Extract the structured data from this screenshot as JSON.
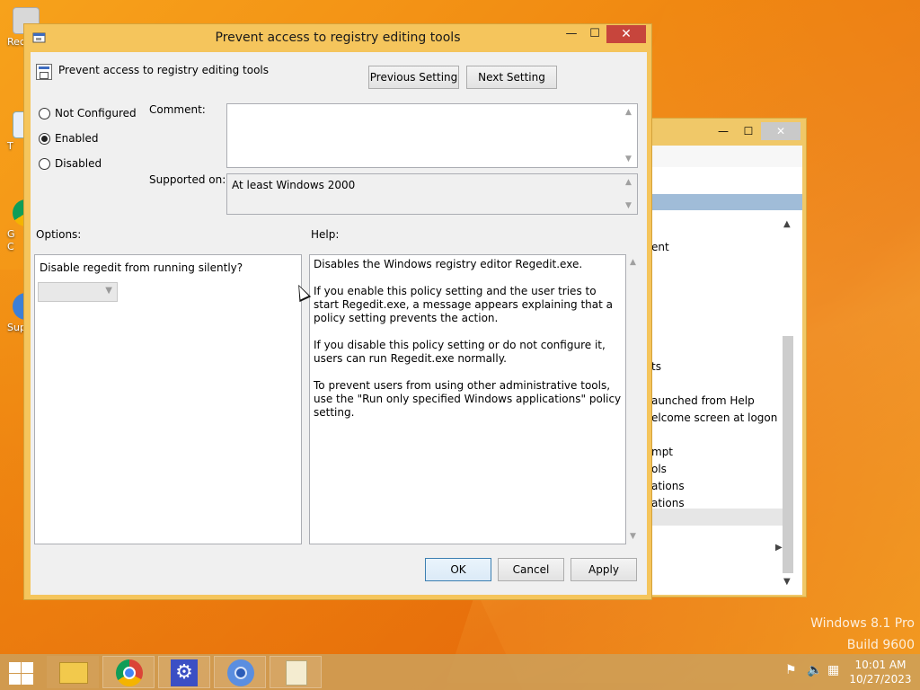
{
  "desktop": {
    "icons": [
      {
        "label": "Rec"
      },
      {
        "label": "T"
      },
      {
        "label": "G\nC"
      },
      {
        "label": "Sup"
      }
    ],
    "watermark": {
      "line1": "Windows 8.1 Pro",
      "line2": "Build 9600"
    }
  },
  "background_window": {
    "items": [
      "ent",
      "ts",
      "aunched from Help",
      "elcome screen at logon",
      "mpt",
      "ols",
      "ations",
      "ations"
    ],
    "close": "✕",
    "max": "☐",
    "min": "—"
  },
  "dialog": {
    "title": "Prevent access to registry editing tools",
    "policy_name": "Prevent access to registry editing tools",
    "prev_button": "Previous Setting",
    "next_button": "Next Setting",
    "options": {
      "not_configured": "Not Configured",
      "enabled": "Enabled",
      "disabled": "Disabled",
      "selected": "enabled"
    },
    "comment_label": "Comment:",
    "supported_label": "Supported on:",
    "supported_value": "At least Windows 2000",
    "options_label": "Options:",
    "help_label": "Help:",
    "option_question": "Disable regedit from running silently?",
    "help": [
      "Disables the Windows registry editor Regedit.exe.",
      "If you enable this policy setting and the user tries to start Regedit.exe, a message appears explaining that a policy setting prevents the action.",
      "If you disable this policy setting or do not configure it, users can run Regedit.exe normally.",
      "To prevent users from using other administrative tools, use the \"Run only specified Windows applications\" policy setting."
    ],
    "ok": "OK",
    "cancel": "Cancel",
    "apply": "Apply",
    "close": "✕",
    "max": "☐",
    "min": "—"
  },
  "taskbar": {
    "time": "10:01 AM",
    "date": "10/27/2023"
  },
  "colors": {
    "accent": "#f5c55c",
    "close_red": "#c7453c"
  }
}
